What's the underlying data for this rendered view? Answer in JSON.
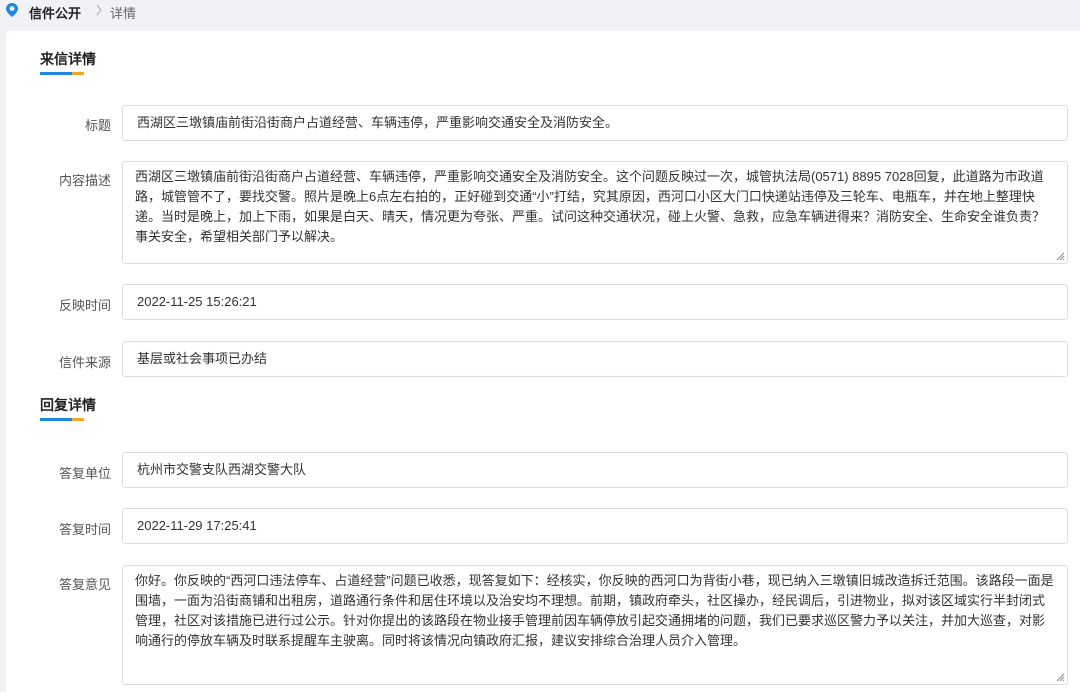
{
  "breadcrumb": {
    "root": "信件公开",
    "current": "详情"
  },
  "letter": {
    "section_title": "来信详情",
    "title_label": "标题",
    "title_value": "西湖区三墩镇庙前街沿街商户占道经营、车辆违停，严重影响交通安全及消防安全。",
    "content_label": "内容描述",
    "content_value": "西湖区三墩镇庙前街沿街商户占道经营、车辆违停，严重影响交通安全及消防安全。这个问题反映过一次，城管执法局(0571) 8895 7028回复，此道路为市政道路，城管管不了，要找交警。照片是晚上6点左右拍的，正好碰到交通“小”打结，究其原因，西河口小区大门口快递站违停及三轮车、电瓶车，并在地上整理快递。当时是晚上，加上下雨，如果是白天、晴天，情况更为夸张、严重。试问这种交通状况，碰上火警、急救，应急车辆进得来？消防安全、生命安全谁负责？事关安全，希望相关部门予以解决。",
    "time_label": "反映时间",
    "time_value": "2022-11-25 15:26:21",
    "source_label": "信件来源",
    "source_value": "基层或社会事项已办结"
  },
  "reply": {
    "section_title": "回复详情",
    "unit_label": "答复单位",
    "unit_value": "杭州市交警支队西湖交警大队",
    "time_label": "答复时间",
    "time_value": "2022-11-29 17:25:41",
    "opinion_label": "答复意见",
    "opinion_value": "你好。你反映的“西河口违法停车、占道经营”问题已收悉，现答复如下：经核实，你反映的西河口为背街小巷，现已纳入三墩镇旧城改造拆迁范围。该路段一面是围墙，一面为沿街商铺和出租房，道路通行条件和居住环境以及治安均不理想。前期，镇政府牵头，社区操办，经民调后，引进物业，拟对该区域实行半封闭式管理，社区对该措施已进行过公示。针对你提出的该路段在物业接手管理前因车辆停放引起交通拥堵的问题，我们已要求巡区警力予以关注，并加大巡查，对影响通行的停放车辆及时联系提醒车主驶离。同时将该情况向镇政府汇报，建议安排综合治理人员介入管理。"
  },
  "colors": {
    "accent_blue": "#1e88e5",
    "accent_orange": "#f5a623",
    "border": "#dcdfe6"
  }
}
